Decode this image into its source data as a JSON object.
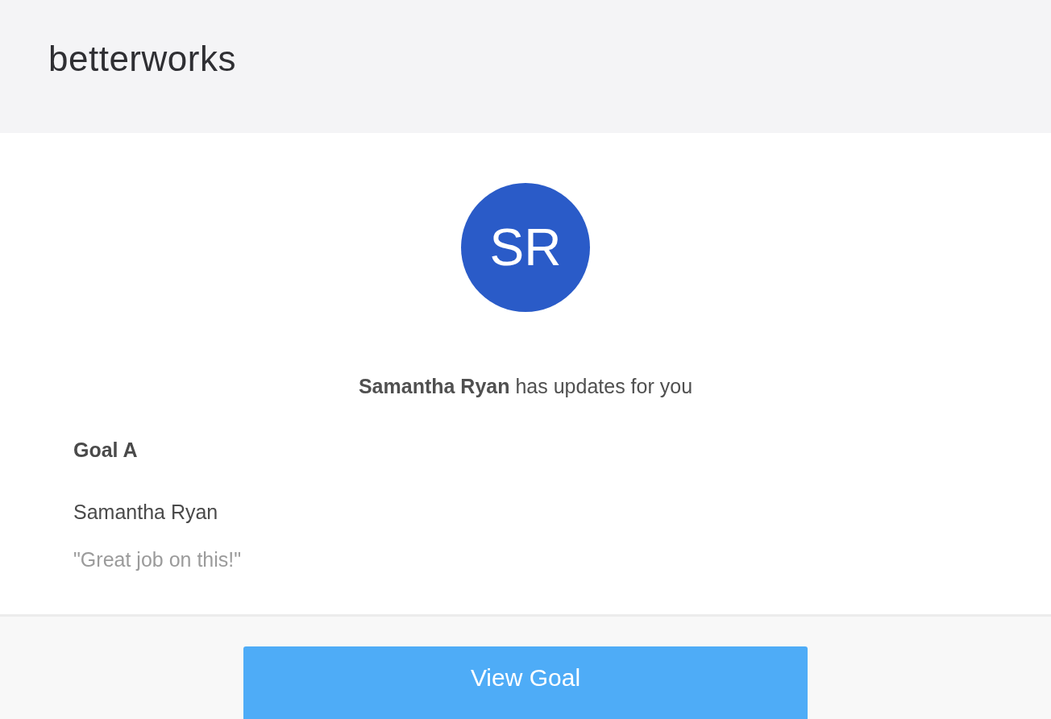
{
  "header": {
    "logo": "betterworks"
  },
  "avatar": {
    "initials": "SR",
    "color": "#2a5bc8"
  },
  "headline": "**Samantha Ryan** has updates for you",
  "update": {
    "goal": "Goal A",
    "author": "Samantha Ryan",
    "comment": "\"Great job on this!\""
  },
  "button": {
    "label": "View Goal"
  }
}
